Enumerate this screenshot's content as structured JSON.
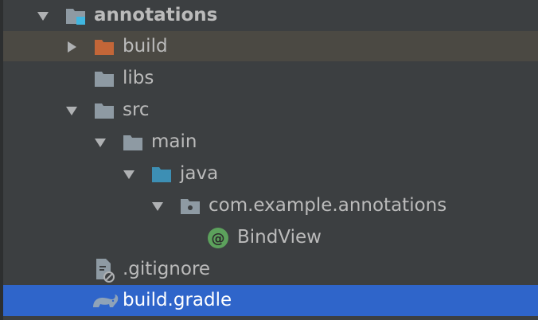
{
  "tree": {
    "root": {
      "label": "annotations"
    },
    "build": {
      "label": "build"
    },
    "libs": {
      "label": "libs"
    },
    "src": {
      "label": "src"
    },
    "main": {
      "label": "main"
    },
    "java": {
      "label": "java"
    },
    "package": {
      "label": "com.example.annotations"
    },
    "bindview": {
      "label": "BindView"
    },
    "gitignore": {
      "label": ".gitignore"
    },
    "buildgradle": {
      "label": "build.gradle"
    }
  },
  "icons": {
    "root": "module-folder-icon",
    "build": "excluded-folder-icon",
    "libs": "folder-icon",
    "src": "folder-icon",
    "main": "folder-icon",
    "java": "source-root-folder-icon",
    "package": "package-icon",
    "bindview": "annotation-icon",
    "gitignore": "ignore-file-icon",
    "buildgradle": "gradle-icon"
  },
  "colors": {
    "background": "#3c3f41",
    "hover_row": "#4b4943",
    "selected_row": "#2f65ca",
    "text": "#bbbbbb",
    "folder": "#8e9aa3",
    "excluded_folder": "#c36638",
    "source_folder": "#3d8fb4",
    "annotation_badge": "#5ca15c",
    "module_marker": "#40b6e0"
  }
}
